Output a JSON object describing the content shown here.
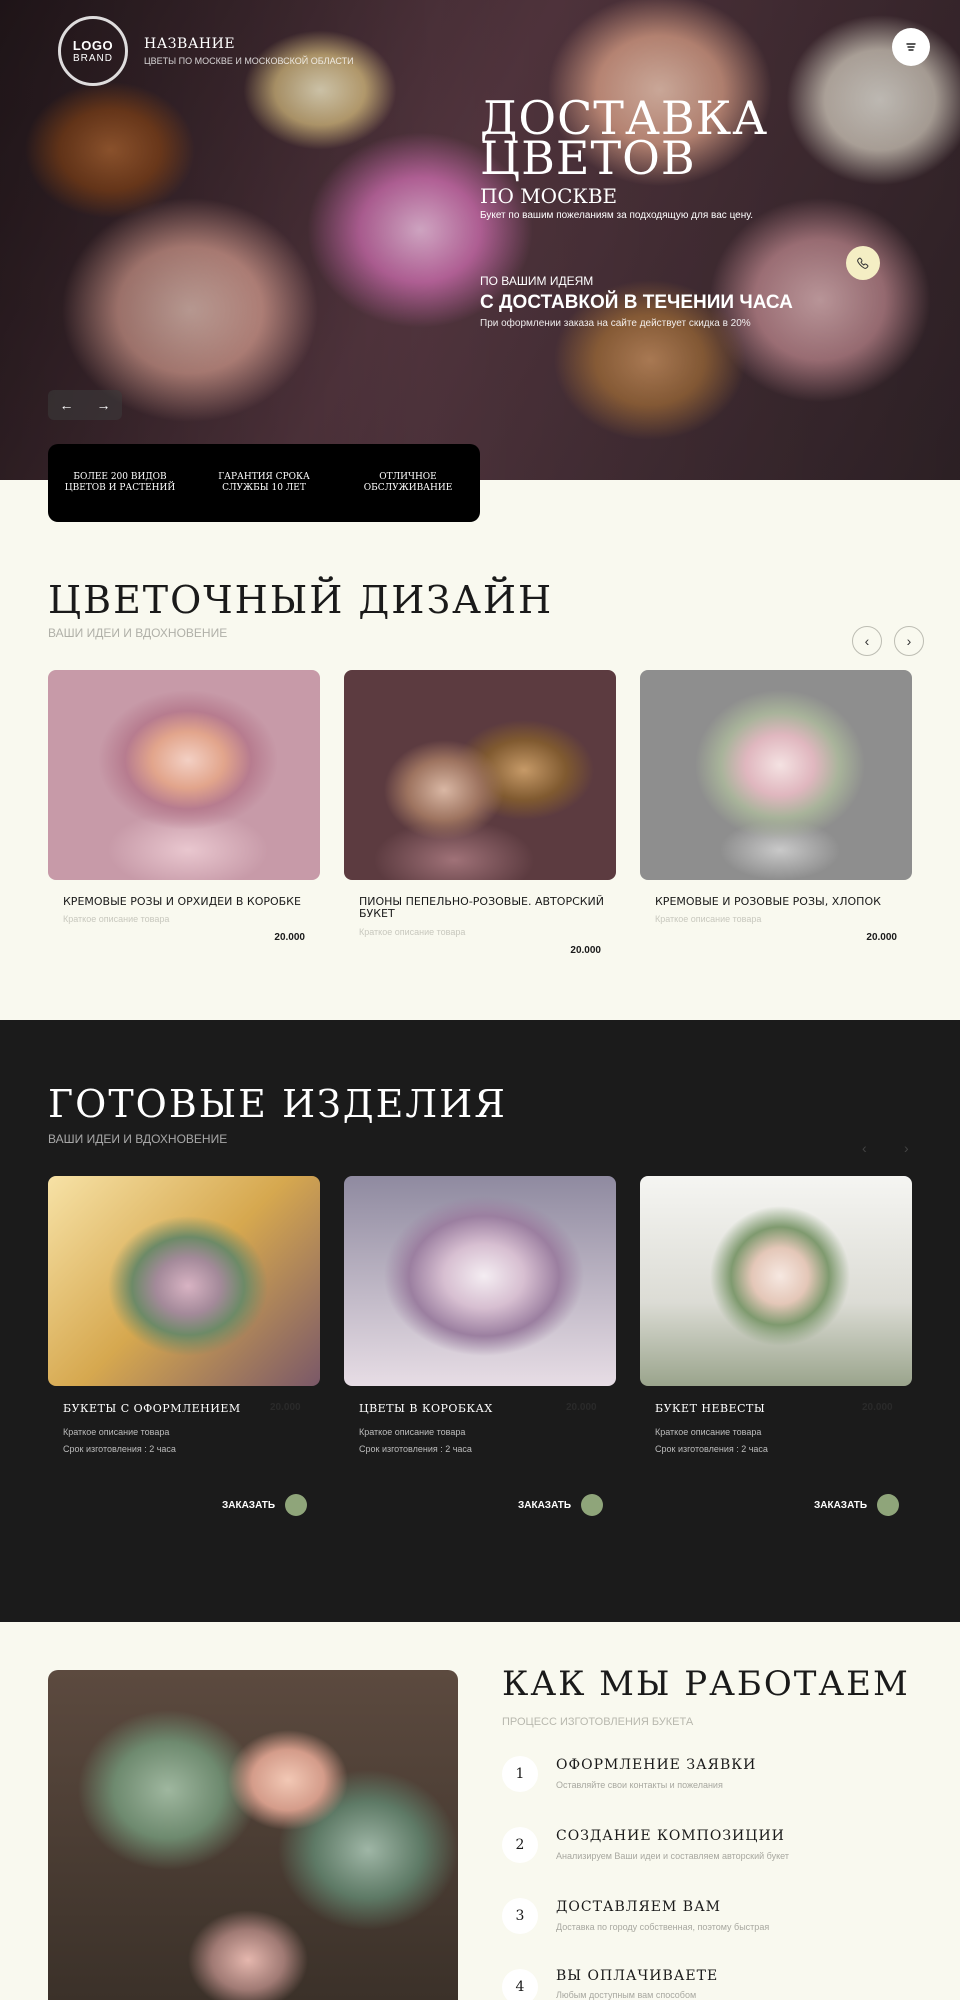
{
  "header": {
    "logo_main": "LOGO",
    "logo_sub": "BRAND",
    "brand_name": "НАЗВАНИЕ",
    "brand_tagline": "ЦВЕТЫ ПО МОСКВЕ И МОСКОВСКОЙ ОБЛАСТИ",
    "menu_icon": "menu-icon"
  },
  "hero": {
    "title_line1": "ДОСТАВКА",
    "title_line2": "ЦВЕТОВ",
    "subtitle": "ПО МОСКВЕ",
    "description": "Букет по вашим пожеланиям за подходящую для вас цену.",
    "promo_kicker": "ПО ВАШИМ ИДЕЯМ",
    "promo_title": "С ДОСТАВКОЙ В ТЕЧЕНИИ ЧАСА",
    "promo_note": "При оформлении заказа на сайте действует скидка в 20%",
    "phone_icon": "phone-icon",
    "prev_arrow": "←",
    "next_arrow": "→"
  },
  "features": [
    "БОЛЕЕ 200 ВИДОВ ЦВЕТОВ И РАСТЕНИЙ",
    "ГАРАНТИЯ СРОКА СЛУЖБЫ 10 ЛЕТ",
    "ОТЛИЧНОЕ ОБСЛУЖИВАНИЕ"
  ],
  "design": {
    "title": "ЦВЕТОЧНЫЙ ДИЗАЙН",
    "subtitle": "ВАШИ ИДЕИ И ВДОХНОВЕНИЕ",
    "prev": "‹",
    "next": "›",
    "items": [
      {
        "name": "КРЕМОВЫЕ РОЗЫ И ОРХИДЕИ В КОРОБКЕ",
        "desc": "Краткое описание товара",
        "price": "20.000"
      },
      {
        "name": "ПИОНЫ  ПЕПЕЛЬНО-РОЗОВЫЕ. АВТОРСКИЙ БУКЕТ",
        "desc": "Краткое описание товара",
        "price": "20.000"
      },
      {
        "name": "КРЕМОВЫЕ И РОЗОВЫЕ РОЗЫ, ХЛОПОК",
        "desc": "Краткое описание товара",
        "price": "20.000"
      }
    ]
  },
  "ready": {
    "title": "ГОТОВЫЕ ИЗДЕЛИЯ",
    "subtitle": "ВАШИ ИДЕИ И ВДОХНОВЕНИЕ",
    "prev": "‹",
    "next": "›",
    "order_label": "ЗАКАЗАТЬ",
    "accent_color": "#8fa57a",
    "items": [
      {
        "name": "БУКЕТЫ С ОФОРМЛЕНИЕМ",
        "price": "20.000",
        "desc": "Краткое описание товара",
        "time": "Срок изготовления : 2 часа"
      },
      {
        "name": "ЦВЕТЫ В КОРОБКАХ",
        "price": "20.000",
        "desc": "Краткое описание товара",
        "time": "Срок изготовления : 2 часа"
      },
      {
        "name": "БУКЕТ НЕВЕСТЫ",
        "price": "20.000",
        "desc": "Краткое описание товара",
        "time": "Срок изготовления : 2 часа"
      }
    ]
  },
  "work": {
    "title": "КАК МЫ РАБОТАЕМ",
    "subtitle": "ПРОЦЕСС ИЗГОТОВЛЕНИЯ БУКЕТА",
    "steps": [
      {
        "num": "1",
        "title": "ОФОРМЛЕНИЕ ЗАЯВКИ",
        "desc": "Оставляйте свои контакты и пожелания"
      },
      {
        "num": "2",
        "title": "СОЗДАНИЕ КОМПОЗИЦИИ",
        "desc": "Анализируем Ваши идеи и составляем авторский букет"
      },
      {
        "num": "3",
        "title": "ДОСТАВЛЯЕМ ВАМ",
        "desc": "Доставка по городу собственная, поэтому быстрая"
      },
      {
        "num": "4",
        "title": "ВЫ ОПЛАЧИВАЕТЕ",
        "desc": "Любым доступным вам способом"
      }
    ]
  },
  "colors": {
    "page_bg": "#f9f9ef",
    "dark_section": "#1b1b1b",
    "features_bg": "#000000",
    "phone_btn": "#f4eec4"
  }
}
